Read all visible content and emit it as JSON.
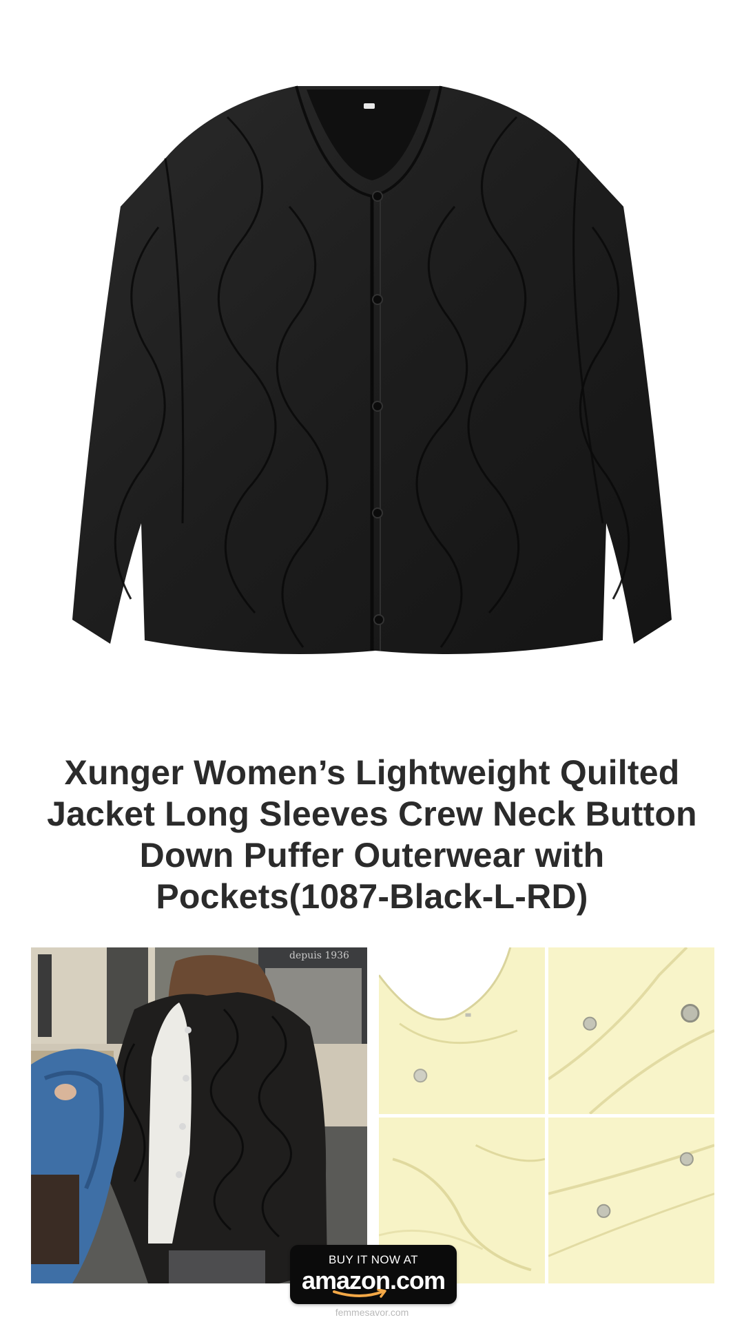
{
  "product": {
    "title": "Xunger Women’s Lightweight Quilted Jacket Long Sleeves Crew Neck Button Down Puffer Outerwear with Pockets(1087-Black-L-RD)"
  },
  "gallery": {
    "main_photo_sign_text": "depuis 1936"
  },
  "cta": {
    "top_label": "BUY IT NOW AT",
    "brand_label": "amazon.com"
  },
  "footer": {
    "site": "femmesavor.com"
  },
  "colors": {
    "jacket": "#1c1c1c",
    "detail_fabric": "#f7f3c6",
    "title_text": "#2b2b2b",
    "button_bg": "#0b0b0b",
    "amazon_smile": "#f3a847"
  }
}
